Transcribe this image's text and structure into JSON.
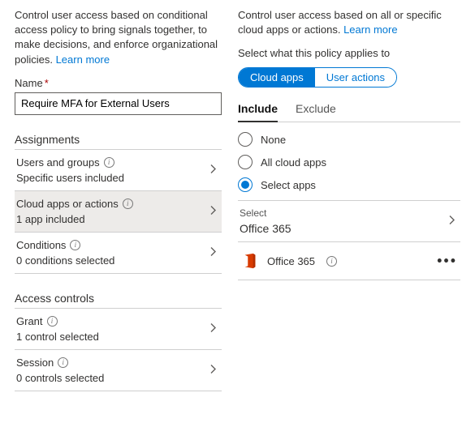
{
  "left": {
    "intro_pre": "Control user access based on conditional access policy to bring signals together, to make decisions, and enforce organizational policies. ",
    "learn_more": "Learn more",
    "name_label": "Name",
    "name_value": "Require MFA for External Users",
    "assignments_head": "Assignments",
    "rows": {
      "users": {
        "title": "Users and groups",
        "sub": "Specific users included"
      },
      "apps": {
        "title": "Cloud apps or actions",
        "sub": "1 app included"
      },
      "cond": {
        "title": "Conditions",
        "sub": "0 conditions selected"
      }
    },
    "access_head": "Access controls",
    "grant": {
      "title": "Grant",
      "sub": "1 control selected"
    },
    "session": {
      "title": "Session",
      "sub": "0 controls selected"
    }
  },
  "right": {
    "intro_pre": "Control user access based on all or specific cloud apps or actions. ",
    "learn_more": "Learn more",
    "applies_label": "Select what this policy applies to",
    "pills": {
      "cloud": "Cloud apps",
      "user": "User actions"
    },
    "tabs": {
      "include": "Include",
      "exclude": "Exclude"
    },
    "radios": {
      "none": "None",
      "all": "All cloud apps",
      "select": "Select apps"
    },
    "select_label": "Select",
    "select_value": "Office 365",
    "app_item": "Office 365"
  }
}
